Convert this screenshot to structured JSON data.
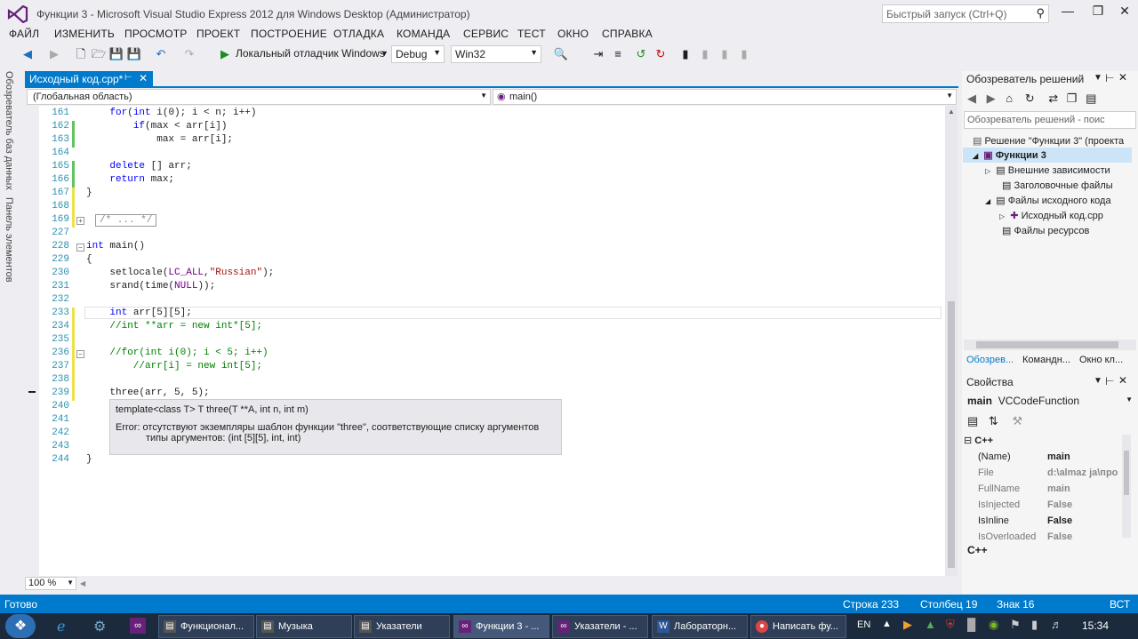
{
  "window": {
    "title": "Функции 3 - Microsoft Visual Studio Express 2012 для Windows Desktop (Администратор)",
    "quick_launch": "Быстрый запуск (Ctrl+Q)"
  },
  "menu": [
    "ФАЙЛ",
    "ИЗМЕНИТЬ",
    "ПРОСМОТР",
    "ПРОЕКТ",
    "ПОСТРОЕНИЕ",
    "ОТЛАДКА",
    "КОМАНДА",
    "СЕРВИС",
    "ТЕСТ",
    "ОКНО",
    "СПРАВКА"
  ],
  "toolbar": {
    "run_label": "Локальный отладчик Windows",
    "config": "Debug",
    "platform": "Win32"
  },
  "left_tabs": [
    "Обозреватель баз данных",
    "Панель элементов"
  ],
  "doc_tab": "Исходный код.cpp*",
  "nav": {
    "scope": "(Глобальная область)",
    "member": "main()"
  },
  "editor": {
    "lines": [
      {
        "n": "161",
        "t": "    for(int i(0); i < n; i++)"
      },
      {
        "n": "162",
        "t": "        if(max < arr[i])"
      },
      {
        "n": "163",
        "t": "            max = arr[i];"
      },
      {
        "n": "164",
        "t": ""
      },
      {
        "n": "165",
        "t": "    delete [] arr;"
      },
      {
        "n": "166",
        "t": "    return max;"
      },
      {
        "n": "167",
        "t": "}"
      },
      {
        "n": "168",
        "t": ""
      },
      {
        "n": "169",
        "t": "/* ... */"
      },
      {
        "n": "227",
        "t": ""
      },
      {
        "n": "228",
        "t": "int main()"
      },
      {
        "n": "229",
        "t": "{"
      },
      {
        "n": "230",
        "t": "    setlocale(LC_ALL,\"Russian\");"
      },
      {
        "n": "231",
        "t": "    srand(time(NULL));"
      },
      {
        "n": "232",
        "t": ""
      },
      {
        "n": "233",
        "t": "    int arr[5][5];"
      },
      {
        "n": "234",
        "t": "    //int **arr = new int*[5];"
      },
      {
        "n": "235",
        "t": ""
      },
      {
        "n": "236",
        "t": "    //for(int i(0); i < 5; i++)"
      },
      {
        "n": "237",
        "t": "        //arr[i] = new int[5];"
      },
      {
        "n": "238",
        "t": ""
      },
      {
        "n": "239",
        "t": "    three(arr, 5, 5);"
      },
      {
        "n": "240",
        "t": ""
      },
      {
        "n": "241",
        "t": ""
      },
      {
        "n": "242",
        "t": ""
      },
      {
        "n": "243",
        "t": ""
      },
      {
        "n": "244",
        "t": "}"
      }
    ],
    "tooltip": {
      "signature": "template<class T> T three(T **A, int n, int m)",
      "error1": "Error: отсутствуют экземпляры шаблон функции \"three\", соответствующие списку аргументов",
      "error2": "типы аргументов: (int [5][5], int, int)"
    },
    "zoom": "100 %"
  },
  "solution_explorer": {
    "title": "Обозреватель решений",
    "search": "Обозреватель решений - поис",
    "items": [
      "Решение \"Функции 3\" (проекта",
      "Функции 3",
      "Внешние зависимости",
      "Заголовочные файлы",
      "Файлы исходного кода",
      "Исходный код.cpp",
      "Файлы ресурсов"
    ],
    "tabs": [
      "Обозрев...",
      "Командн...",
      "Окно кл..."
    ]
  },
  "properties": {
    "title": "Свойства",
    "object": "main",
    "object_type": "VCCodeFunction",
    "category": "C++",
    "rows": [
      {
        "k": "(Name)",
        "v": "main"
      },
      {
        "k": "File",
        "v": "d:\\almaz ja\\про"
      },
      {
        "k": "FullName",
        "v": "main"
      },
      {
        "k": "IsInjected",
        "v": "False"
      },
      {
        "k": "IsInline",
        "v": "False"
      },
      {
        "k": "IsOverloaded",
        "v": "False"
      }
    ],
    "footer": "C++"
  },
  "status": {
    "ready": "Готово",
    "line": "Строка 233",
    "col": "Столбец 19",
    "char": "Знак 16",
    "mode": "ВСТ"
  },
  "taskbar": {
    "tasks": [
      "Функционал...",
      "Музыка",
      "Указатели",
      "Функции 3 - ...",
      "Указатели - ...",
      "Лабораторн...",
      "Написать фу..."
    ],
    "lang": "EN",
    "clock": "15:34"
  }
}
